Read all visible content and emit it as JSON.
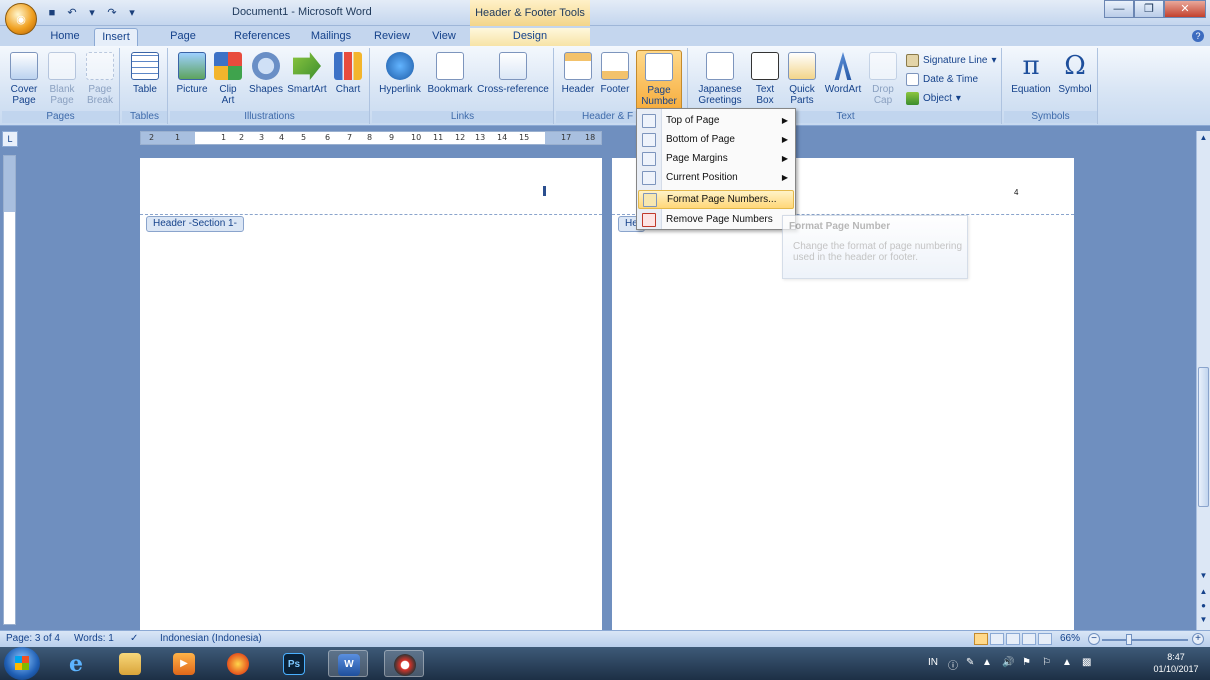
{
  "app": {
    "document_title": "Document1 - Microsoft Word",
    "context_tool_title": "Header & Footer Tools"
  },
  "tabs": [
    "Home",
    "Insert",
    "Page Layout",
    "References",
    "Mailings",
    "Review",
    "View",
    "Design"
  ],
  "ribbon": {
    "pages": {
      "label": "Pages",
      "cover_page": "Cover Page",
      "blank_page": "Blank Page",
      "page_break": "Page Break"
    },
    "tables": {
      "label": "Tables",
      "table": "Table"
    },
    "illustrations": {
      "label": "Illustrations",
      "picture": "Picture",
      "clip_art": "Clip Art",
      "shapes": "Shapes",
      "smartart": "SmartArt",
      "chart": "Chart"
    },
    "links": {
      "label": "Links",
      "hyperlink": "Hyperlink",
      "bookmark": "Bookmark",
      "cross_reference": "Cross-reference"
    },
    "header_footer": {
      "label": "Header & F",
      "header": "Header",
      "footer": "Footer",
      "page_number": "Page Number"
    },
    "text": {
      "label": "Text",
      "japanese_greetings": "Japanese Greetings",
      "text_box": "Text Box",
      "quick_parts": "Quick Parts",
      "wordart": "WordArt",
      "drop_cap": "Drop Cap",
      "signature_line": "Signature Line",
      "date_time": "Date & Time",
      "object": "Object"
    },
    "symbols": {
      "label": "Symbols",
      "equation": "Equation",
      "symbol": "Symbol"
    }
  },
  "menu": {
    "items": [
      "Top of Page",
      "Bottom of Page",
      "Page Margins",
      "Current Position",
      "Format Page Numbers...",
      "Remove Page Numbers"
    ]
  },
  "tooltip": {
    "title": "Format Page Number",
    "body": "Change the format of page numbering used in the header or footer."
  },
  "pages": {
    "left_header_tab": "Header -Section 1-",
    "right_header_tab": "He",
    "right_page_number": "4"
  },
  "ruler": {
    "numbers": [
      "2",
      "1",
      "1",
      "2",
      "3",
      "4",
      "5",
      "6",
      "7",
      "8",
      "9",
      "10",
      "11",
      "12",
      "13",
      "14",
      "15",
      "17",
      "18"
    ]
  },
  "status": {
    "page": "Page: 3 of 4",
    "words": "Words: 1",
    "language": "Indonesian (Indonesia)",
    "zoom": "66%"
  },
  "taskbar": {
    "language": "IN",
    "time": "8:47",
    "date": "01/10/2017"
  }
}
